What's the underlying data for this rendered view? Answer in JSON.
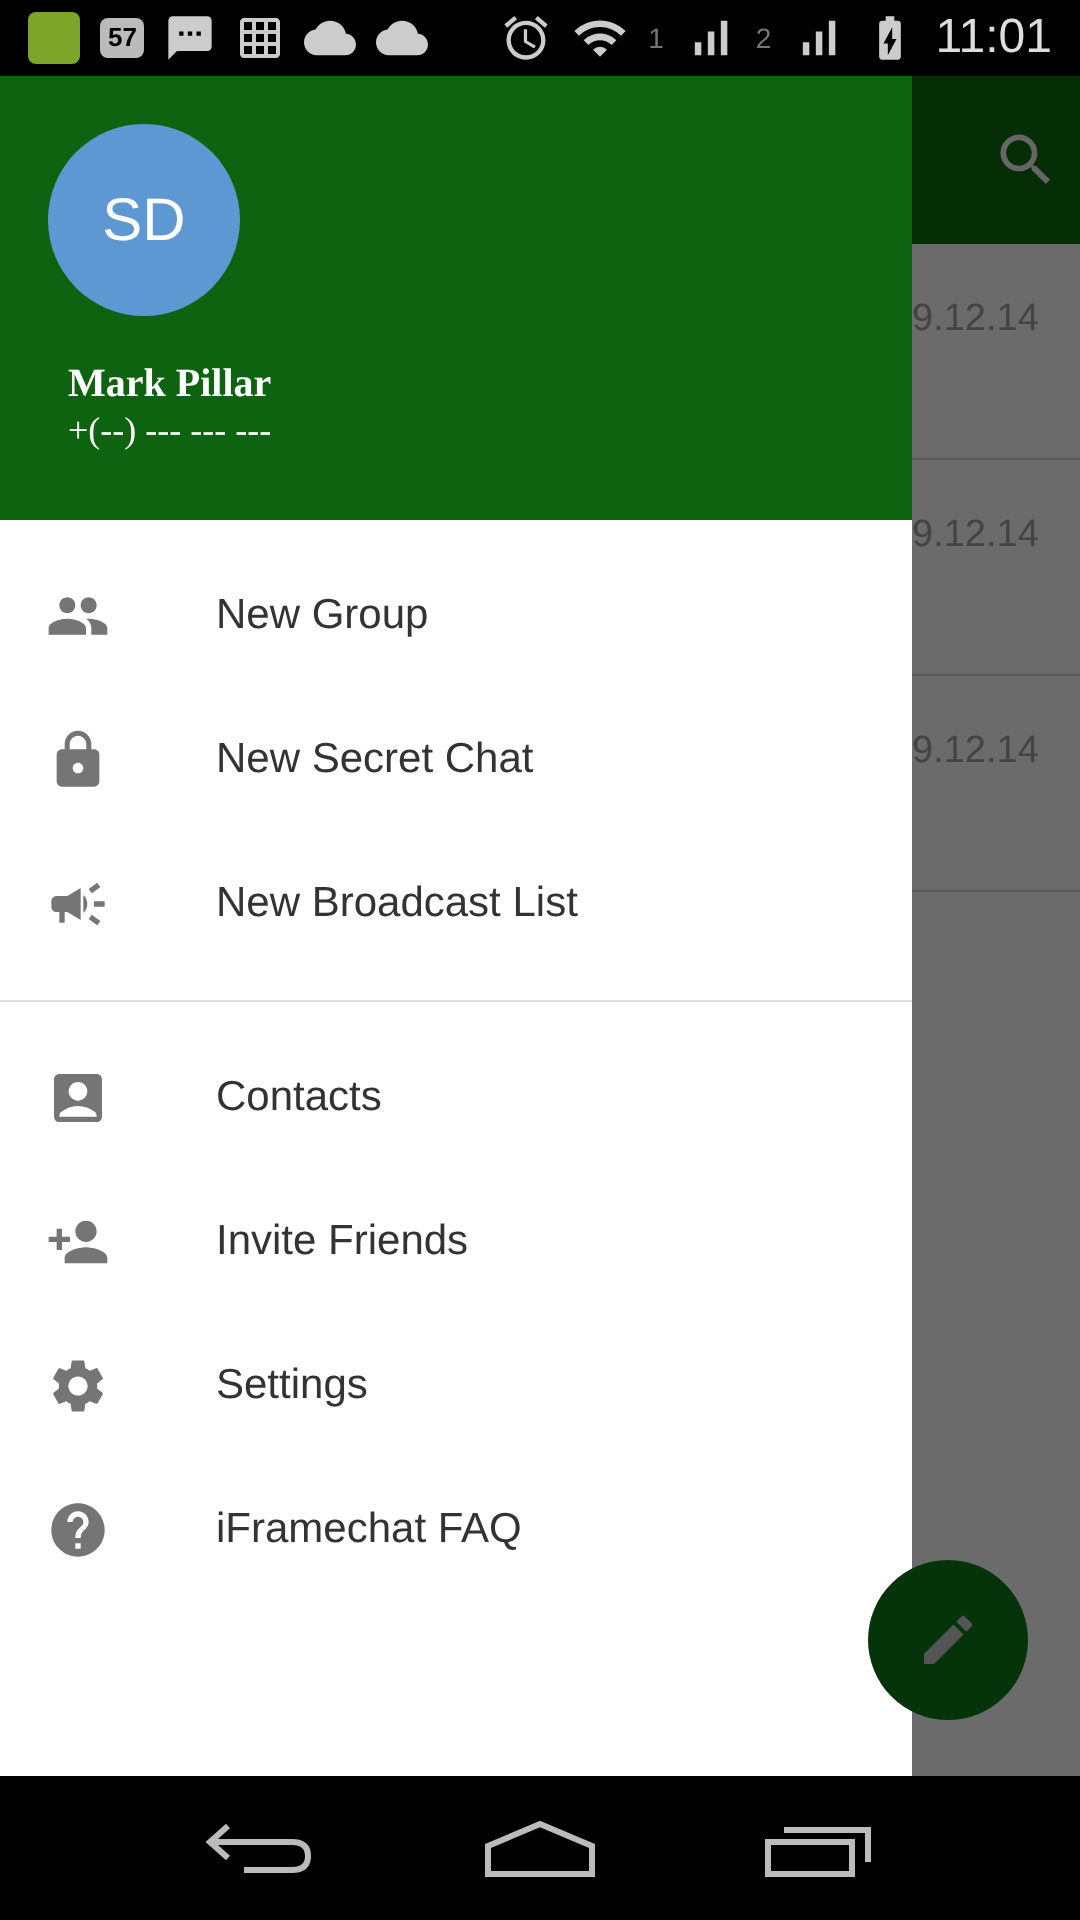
{
  "status_bar": {
    "notification_count": "57",
    "sim_1": "1",
    "sim_2": "2",
    "time": "11:01"
  },
  "drawer": {
    "avatar_initials": "SD",
    "name": "Mark Pillar",
    "phone": "+(--) --- --- ---",
    "groups": [
      [
        {
          "kind": "group",
          "label": "New Group"
        },
        {
          "kind": "lock",
          "label": "New Secret Chat"
        },
        {
          "kind": "broadcast",
          "label": "New Broadcast List"
        }
      ],
      [
        {
          "kind": "contacts",
          "label": "Contacts"
        },
        {
          "kind": "invite",
          "label": "Invite Friends"
        },
        {
          "kind": "settings",
          "label": "Settings"
        },
        {
          "kind": "help",
          "label": "iFramechat FAQ"
        }
      ]
    ]
  },
  "chat_list": {
    "dates": [
      "9.12.14",
      "9.12.14",
      "9.12.14"
    ]
  }
}
